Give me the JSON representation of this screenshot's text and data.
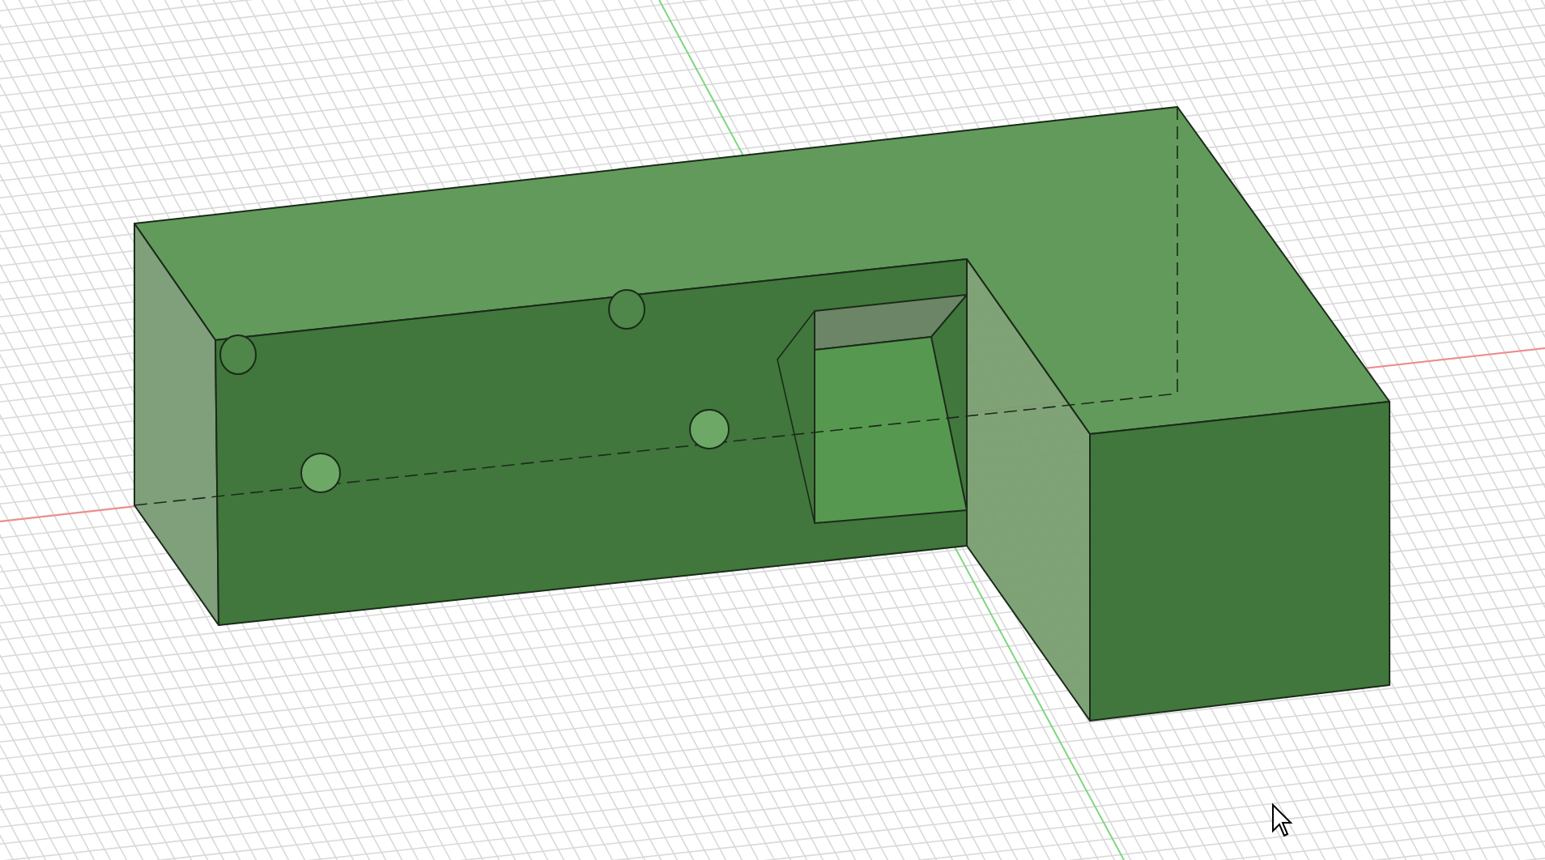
{
  "viewport": {
    "cursor_visible": true
  }
}
